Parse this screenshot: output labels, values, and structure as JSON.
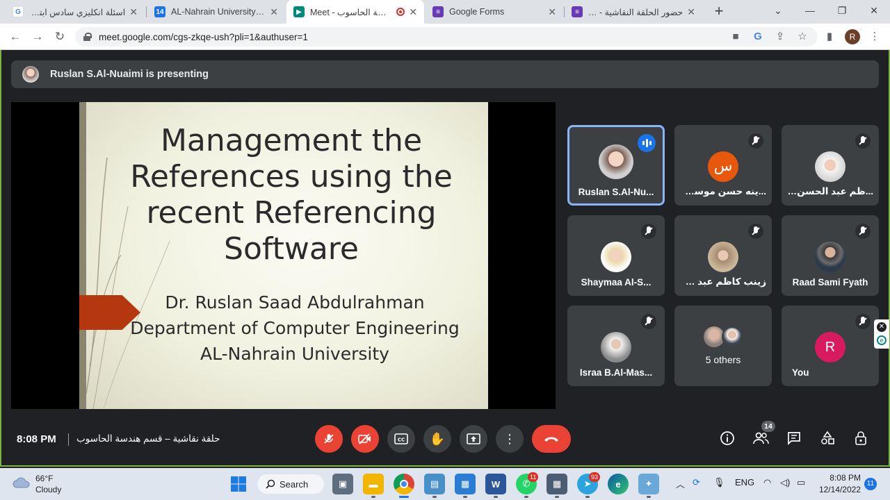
{
  "browser": {
    "tabs": [
      {
        "label": "اسئلة انكليزي سادس ابتدائي",
        "favicon": "google-icon",
        "color": "#4285f4"
      },
      {
        "label": "AL-Nahrain University - C",
        "favicon": "calendar-icon",
        "color": "#1a73e8"
      },
      {
        "label": "Meet - قسم هندسة الحاسوب",
        "favicon": "meet-icon",
        "color": "#00897b"
      },
      {
        "label": "Google Forms",
        "favicon": "forms-icon",
        "color": "#673ab7"
      },
      {
        "label": "حضور الحلقة النقاشية - ms",
        "favicon": "forms-icon",
        "color": "#673ab7"
      }
    ],
    "url": "meet.google.com/cgs-zkqe-ush?pli=1&authuser=1",
    "profile_initial": "R"
  },
  "meet": {
    "presenting_text": "Ruslan S.Al-Nuaimi is presenting",
    "slide": {
      "title_lines": [
        "Management the",
        "References using the",
        "recent Referencing",
        "Software"
      ],
      "sub_lines": [
        "Dr. Ruslan Saad Abdulrahman",
        "Department of Computer Engineering",
        "AL-Nahrain University"
      ]
    },
    "participants": [
      {
        "name": "Ruslan S.Al-Nu...",
        "state": "speaking",
        "avatar": "photo"
      },
      {
        "name": "...ينه حسن موسى حسن",
        "state": "muted",
        "avatar": "letter",
        "letter": "س",
        "color": "#e8580c"
      },
      {
        "name": "...ظم عبد الحسن سلمان",
        "state": "muted",
        "avatar": "photo"
      },
      {
        "name": "Shaymaa Al-S...",
        "state": "muted",
        "avatar": "photo"
      },
      {
        "name": "زينب كاظم عبد سلمان",
        "state": "muted",
        "avatar": "photo"
      },
      {
        "name": "Raad Sami Fyath",
        "state": "muted",
        "avatar": "photo"
      },
      {
        "name": "Israa B.Al-Mas...",
        "state": "muted",
        "avatar": "photo"
      },
      {
        "name": "5 others",
        "state": "none",
        "avatar": "group"
      },
      {
        "name": "You",
        "state": "muted",
        "avatar": "letter",
        "letter": "R",
        "color": "#d81b60"
      }
    ],
    "controls": {
      "time": "8:08 PM",
      "meeting_name": "حلقة نقاشية – قسم هندسة الحاسوب",
      "participant_count": "14"
    }
  },
  "taskbar": {
    "weather_temp": "66°F",
    "weather_desc": "Cloudy",
    "search_label": "Search",
    "whatsapp_badge": "11",
    "telegram_badge": "93",
    "lang": "ENG",
    "clock_time": "8:08 PM",
    "clock_date": "12/14/2022",
    "notification_count": "11"
  }
}
